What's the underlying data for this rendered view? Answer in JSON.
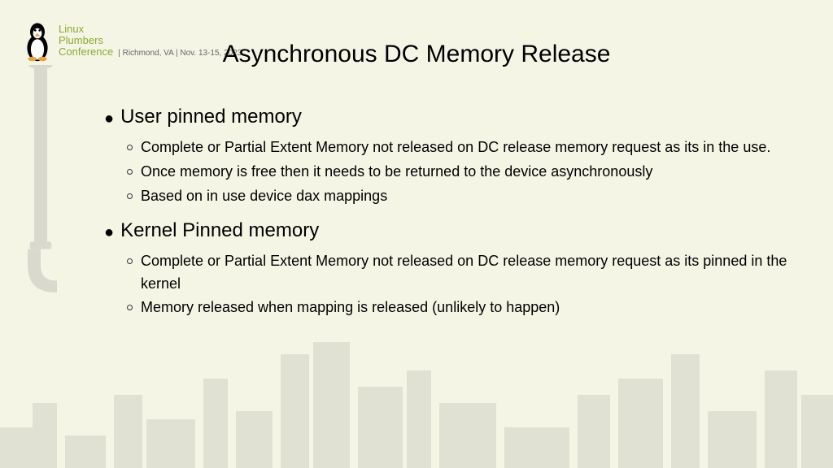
{
  "conference": {
    "line1": "Linux",
    "line2": "Plumbers",
    "line3": "Conference",
    "detail": "| Richmond, VA | Nov. 13-15, 2023"
  },
  "title": "Asynchronous DC Memory Release",
  "sections": [
    {
      "heading": "User pinned memory",
      "items": [
        "Complete or Partial Extent Memory not released on DC release memory request as its in the use.",
        "Once memory is free then it needs to be returned to the device asynchronously",
        "Based on in use device dax mappings"
      ]
    },
    {
      "heading": "Kernel Pinned memory",
      "items": [
        "Complete or Partial Extent Memory not released on DC release memory request as its pinned in the kernel",
        "Memory released when mapping is released (unlikely to happen)"
      ]
    }
  ]
}
